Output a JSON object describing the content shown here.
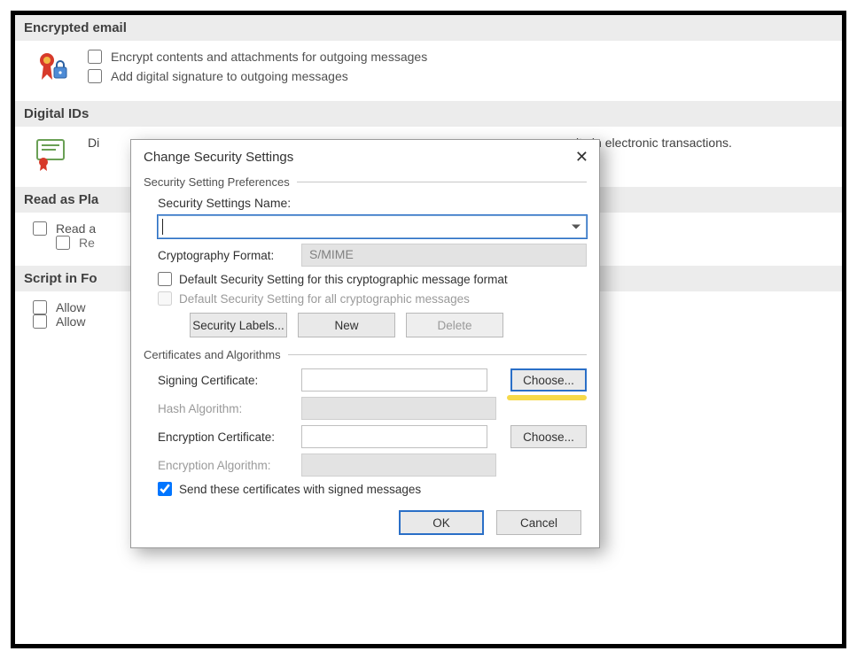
{
  "sections": {
    "encrypted_email": {
      "title": "Encrypted email",
      "encrypt_label": "Encrypt contents and attachments for outgoing messages",
      "add_sig_label": "Add digital signature to outgoing messages"
    },
    "digital_ids": {
      "title": "Digital IDs",
      "leading_fragment": "Di",
      "trailing_fragment": "ity in electronic transactions."
    },
    "read_plain": {
      "title": "Read as Pla",
      "read_a": "Read a",
      "read_sub": "Re"
    },
    "script_folders": {
      "title": "Script in Fo",
      "allow1": "Allow",
      "allow2": "Allow"
    }
  },
  "dialog": {
    "title": "Change Security Settings",
    "group_prefs": "Security Setting Preferences",
    "name_label": "Security Settings Name:",
    "name_value": "",
    "crypto_label": "Cryptography Format:",
    "crypto_value": "S/MIME",
    "default_this": "Default Security Setting for this cryptographic message format",
    "default_all": "Default Security Setting for all cryptographic messages",
    "btn_labels": "Security Labels...",
    "btn_new": "New",
    "btn_delete": "Delete",
    "group_certs": "Certificates and Algorithms",
    "signing_cert_label": "Signing Certificate:",
    "hash_label": "Hash Algorithm:",
    "enc_cert_label": "Encryption Certificate:",
    "enc_alg_label": "Encryption Algorithm:",
    "choose": "Choose...",
    "send_with": "Send these certificates with signed messages",
    "ok": "OK",
    "cancel": "Cancel"
  }
}
